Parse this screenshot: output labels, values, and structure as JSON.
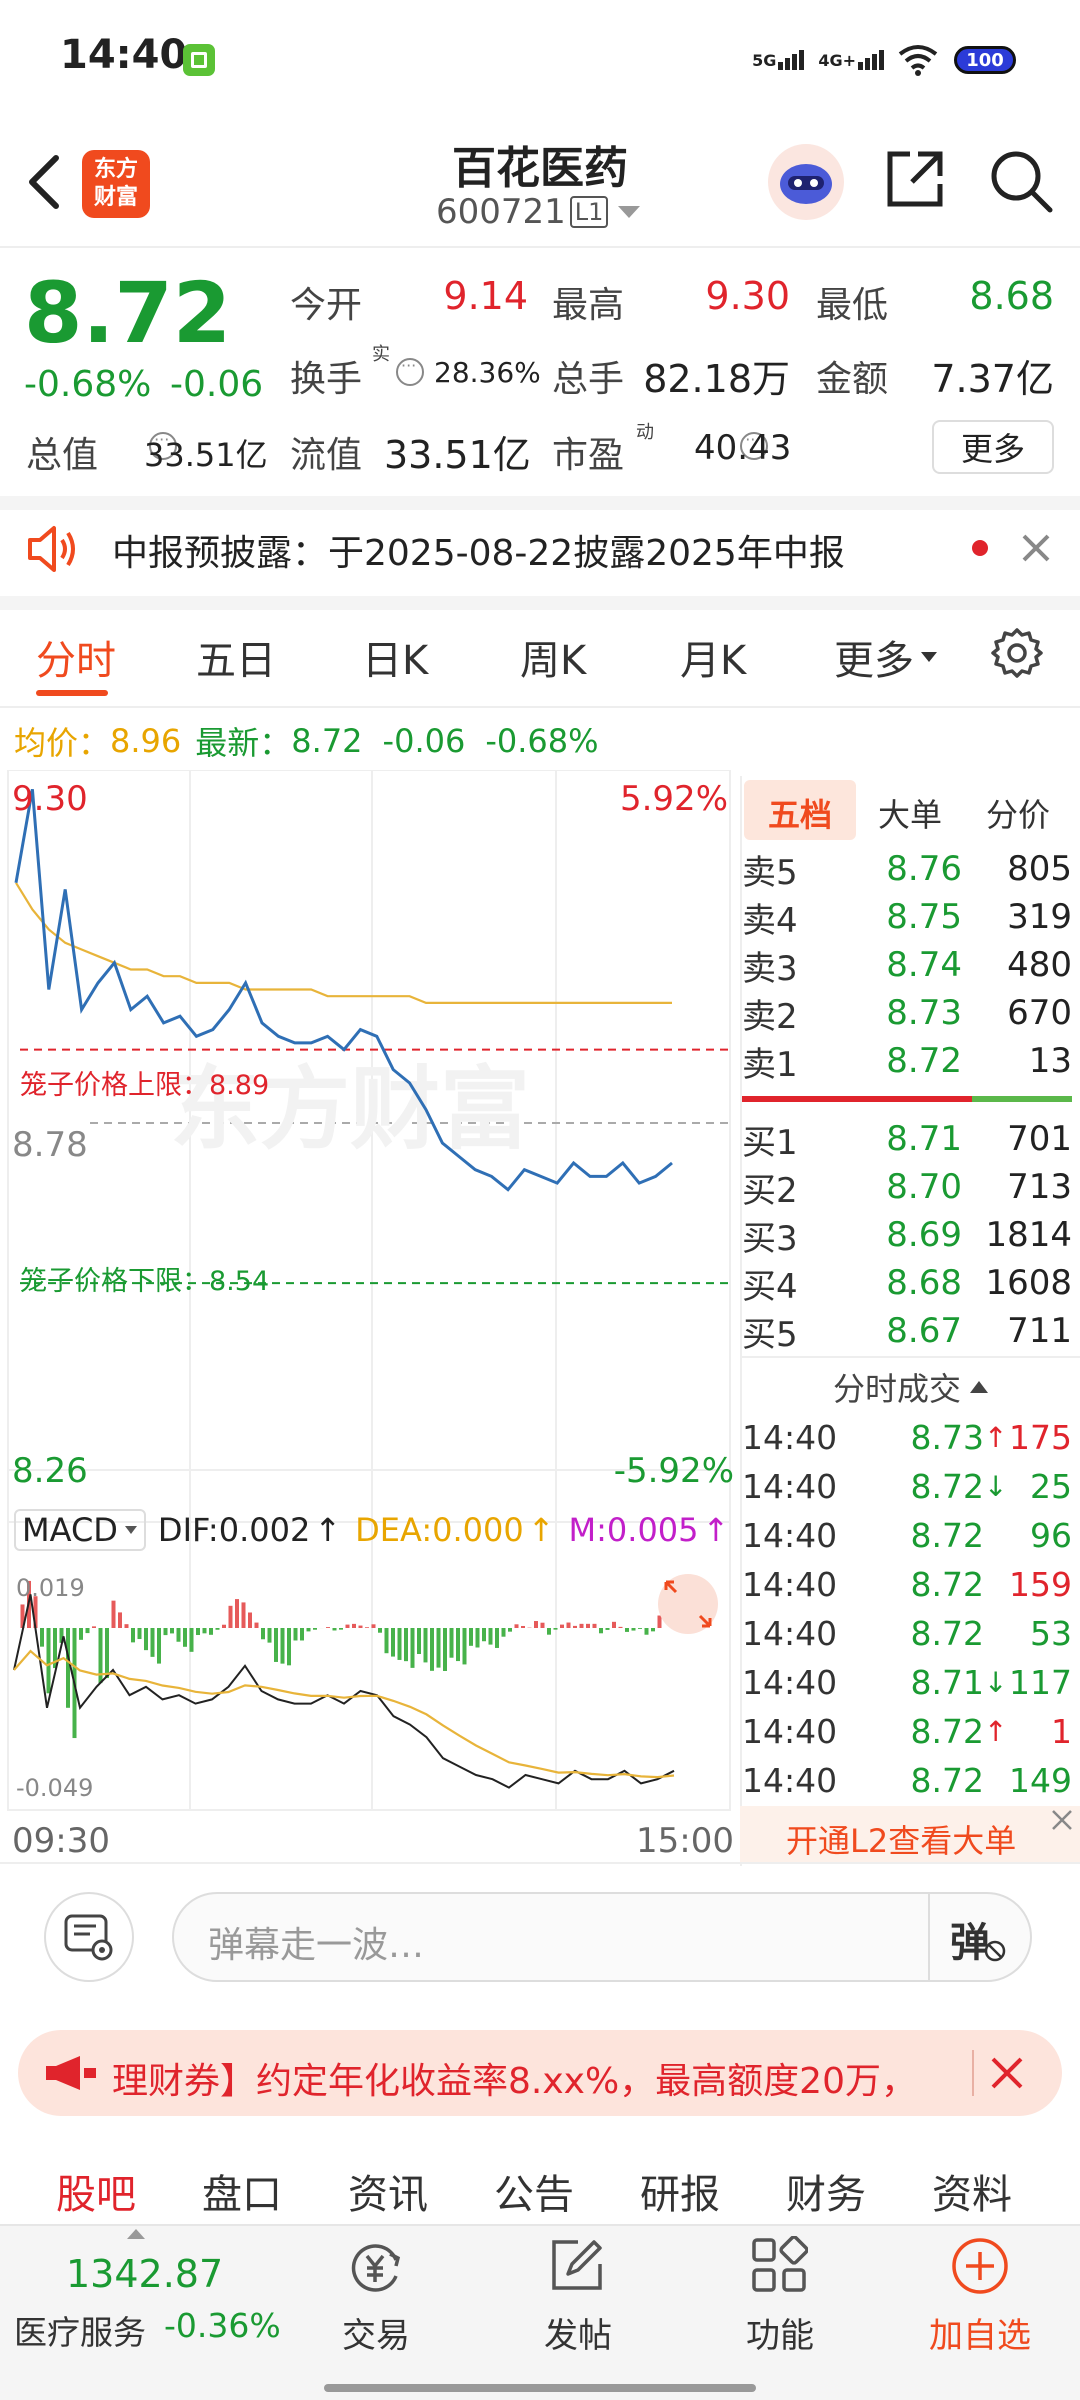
{
  "status_bar": {
    "time": "14:40",
    "net1": "5G",
    "net2": "4G+",
    "battery": "100"
  },
  "header": {
    "logo_text_1": "东方",
    "logo_text_2": "财富",
    "stock_name": "百花医药",
    "stock_code": "600721",
    "level_badge": "L1"
  },
  "quote": {
    "price": "8.72",
    "change_pct": "-0.68%",
    "change": "-0.06",
    "open_label": "今开",
    "open": "9.14",
    "high_label": "最高",
    "high": "9.30",
    "low_label": "最低",
    "low": "8.68",
    "turnover_label": "换手",
    "turnover_sup": "实",
    "turnover": "28.36%",
    "volume_label": "总手",
    "volume": "82.18万",
    "amount_label": "金额",
    "amount": "7.37亿",
    "mcap_label": "总值",
    "mcap": "33.51亿",
    "float_label": "流值",
    "float": "33.51亿",
    "pe_label": "市盈",
    "pe_sup": "动",
    "pe": "40.43",
    "more_button": "更多"
  },
  "notice": {
    "text": "中报预披露：于2025-08-22披露2025年中报"
  },
  "tabs": [
    "分时",
    "五日",
    "日K",
    "周K",
    "月K",
    "更多"
  ],
  "statline": {
    "avg_label": "均价：",
    "avg": "8.96",
    "latest_label": "最新：",
    "latest": "8.72",
    "change": "-0.06",
    "pct": "-0.68%"
  },
  "chart": {
    "y_top": "9.30",
    "y_top_pct": "5.92%",
    "y_mid": "8.78",
    "y_bottom": "8.26",
    "y_bottom_pct": "-5.92%",
    "upper_limit_label": "笼子价格上限：8.89",
    "lower_limit_label": "笼子价格下限：8.54",
    "watermark": "东方财富",
    "x_start": "09:30",
    "x_end": "15:00",
    "macd_label": "MACD",
    "dif": "DIF:0.002",
    "dea": "DEA:0.000",
    "m": "M:0.005",
    "macd_top": "0.019",
    "macd_bottom": "-0.049"
  },
  "chart_data": {
    "type": "line",
    "ylim": [
      8.26,
      9.3
    ],
    "reference": 8.78,
    "upper_limit": 8.89,
    "lower_limit": 8.54,
    "series": [
      {
        "name": "price",
        "values": [
          9.14,
          9.28,
          8.98,
          9.13,
          8.95,
          8.99,
          9.02,
          8.95,
          8.97,
          8.93,
          8.94,
          8.91,
          8.92,
          8.95,
          8.99,
          8.93,
          8.91,
          8.9,
          8.9,
          8.91,
          8.89,
          8.92,
          8.91,
          8.86,
          8.84,
          8.8,
          8.75,
          8.73,
          8.71,
          8.7,
          8.68,
          8.71,
          8.7,
          8.69,
          8.72,
          8.7,
          8.7,
          8.72,
          8.69,
          8.7,
          8.72
        ]
      },
      {
        "name": "avg",
        "values": [
          9.14,
          9.1,
          9.07,
          9.05,
          9.04,
          9.03,
          9.02,
          9.01,
          9.01,
          9.0,
          9.0,
          8.99,
          8.99,
          8.99,
          8.98,
          8.98,
          8.98,
          8.98,
          8.98,
          8.97,
          8.97,
          8.97,
          8.97,
          8.97,
          8.97,
          8.96,
          8.96,
          8.96,
          8.96,
          8.96,
          8.96,
          8.96,
          8.96,
          8.96,
          8.96,
          8.96,
          8.96,
          8.96,
          8.96,
          8.96,
          8.96
        ]
      }
    ]
  },
  "orderbook": {
    "tabs": [
      "五档",
      "大单",
      "分价"
    ],
    "asks": [
      {
        "label": "卖5",
        "price": "8.76",
        "vol": "805"
      },
      {
        "label": "卖4",
        "price": "8.75",
        "vol": "319"
      },
      {
        "label": "卖3",
        "price": "8.74",
        "vol": "480"
      },
      {
        "label": "卖2",
        "price": "8.73",
        "vol": "670"
      },
      {
        "label": "卖1",
        "price": "8.72",
        "vol": "13"
      }
    ],
    "bids": [
      {
        "label": "买1",
        "price": "8.71",
        "vol": "701"
      },
      {
        "label": "买2",
        "price": "8.70",
        "vol": "713"
      },
      {
        "label": "买3",
        "price": "8.69",
        "vol": "1814"
      },
      {
        "label": "买4",
        "price": "8.68",
        "vol": "1608"
      },
      {
        "label": "买5",
        "price": "8.67",
        "vol": "711"
      }
    ],
    "trades_title": "分时成交",
    "trades": [
      {
        "time": "14:40",
        "price": "8.73",
        "arrow": "↑",
        "vol": "175",
        "dir": "up"
      },
      {
        "time": "14:40",
        "price": "8.72",
        "arrow": "↓",
        "vol": "25",
        "dir": "down"
      },
      {
        "time": "14:40",
        "price": "8.72",
        "arrow": "",
        "vol": "96",
        "dir": "down"
      },
      {
        "time": "14:40",
        "price": "8.72",
        "arrow": "",
        "vol": "159",
        "dir": "up"
      },
      {
        "time": "14:40",
        "price": "8.72",
        "arrow": "",
        "vol": "53",
        "dir": "down"
      },
      {
        "time": "14:40",
        "price": "8.71",
        "arrow": "↓",
        "vol": "117",
        "dir": "down"
      },
      {
        "time": "14:40",
        "price": "8.72",
        "arrow": "↑",
        "vol": "1",
        "dir": "up"
      },
      {
        "time": "14:40",
        "price": "8.72",
        "arrow": "",
        "vol": "149",
        "dir": "down"
      }
    ],
    "l2_banner": "开通L2查看大单"
  },
  "comment": {
    "placeholder": "弹幕走一波…",
    "danmu_label": "弹"
  },
  "ad": {
    "text": "理财券】约定年化收益率8.xx%，最高额度20万，"
  },
  "bottom_tabs": [
    "股吧",
    "盘口",
    "资讯",
    "公告",
    "研报",
    "财务",
    "资料"
  ],
  "bottom_bar": {
    "index_value": "1342.87",
    "index_name": "医疗服务",
    "index_pct": "-0.36%",
    "trade": "交易",
    "post": "发帖",
    "func": "功能",
    "add": "加自选"
  },
  "colors": {
    "up": "#e0242c",
    "down": "#1a9a32",
    "accent": "#f04a1e",
    "avg_line": "#e8b43a",
    "price_line": "#2f6fb5"
  }
}
